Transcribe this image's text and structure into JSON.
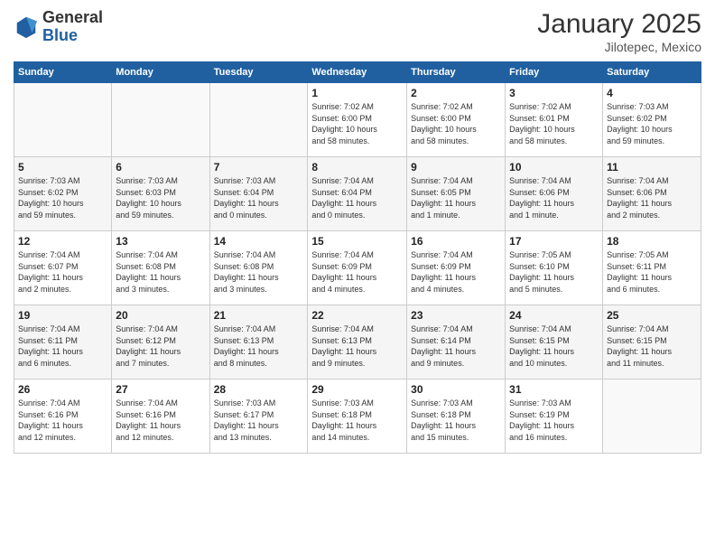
{
  "header": {
    "logo_general": "General",
    "logo_blue": "Blue",
    "month": "January 2025",
    "location": "Jilotepec, Mexico"
  },
  "weekdays": [
    "Sunday",
    "Monday",
    "Tuesday",
    "Wednesday",
    "Thursday",
    "Friday",
    "Saturday"
  ],
  "weeks": [
    [
      {
        "day": "",
        "info": ""
      },
      {
        "day": "",
        "info": ""
      },
      {
        "day": "",
        "info": ""
      },
      {
        "day": "1",
        "info": "Sunrise: 7:02 AM\nSunset: 6:00 PM\nDaylight: 10 hours\nand 58 minutes."
      },
      {
        "day": "2",
        "info": "Sunrise: 7:02 AM\nSunset: 6:00 PM\nDaylight: 10 hours\nand 58 minutes."
      },
      {
        "day": "3",
        "info": "Sunrise: 7:02 AM\nSunset: 6:01 PM\nDaylight: 10 hours\nand 58 minutes."
      },
      {
        "day": "4",
        "info": "Sunrise: 7:03 AM\nSunset: 6:02 PM\nDaylight: 10 hours\nand 59 minutes."
      }
    ],
    [
      {
        "day": "5",
        "info": "Sunrise: 7:03 AM\nSunset: 6:02 PM\nDaylight: 10 hours\nand 59 minutes."
      },
      {
        "day": "6",
        "info": "Sunrise: 7:03 AM\nSunset: 6:03 PM\nDaylight: 10 hours\nand 59 minutes."
      },
      {
        "day": "7",
        "info": "Sunrise: 7:03 AM\nSunset: 6:04 PM\nDaylight: 11 hours\nand 0 minutes."
      },
      {
        "day": "8",
        "info": "Sunrise: 7:04 AM\nSunset: 6:04 PM\nDaylight: 11 hours\nand 0 minutes."
      },
      {
        "day": "9",
        "info": "Sunrise: 7:04 AM\nSunset: 6:05 PM\nDaylight: 11 hours\nand 1 minute."
      },
      {
        "day": "10",
        "info": "Sunrise: 7:04 AM\nSunset: 6:06 PM\nDaylight: 11 hours\nand 1 minute."
      },
      {
        "day": "11",
        "info": "Sunrise: 7:04 AM\nSunset: 6:06 PM\nDaylight: 11 hours\nand 2 minutes."
      }
    ],
    [
      {
        "day": "12",
        "info": "Sunrise: 7:04 AM\nSunset: 6:07 PM\nDaylight: 11 hours\nand 2 minutes."
      },
      {
        "day": "13",
        "info": "Sunrise: 7:04 AM\nSunset: 6:08 PM\nDaylight: 11 hours\nand 3 minutes."
      },
      {
        "day": "14",
        "info": "Sunrise: 7:04 AM\nSunset: 6:08 PM\nDaylight: 11 hours\nand 3 minutes."
      },
      {
        "day": "15",
        "info": "Sunrise: 7:04 AM\nSunset: 6:09 PM\nDaylight: 11 hours\nand 4 minutes."
      },
      {
        "day": "16",
        "info": "Sunrise: 7:04 AM\nSunset: 6:09 PM\nDaylight: 11 hours\nand 4 minutes."
      },
      {
        "day": "17",
        "info": "Sunrise: 7:05 AM\nSunset: 6:10 PM\nDaylight: 11 hours\nand 5 minutes."
      },
      {
        "day": "18",
        "info": "Sunrise: 7:05 AM\nSunset: 6:11 PM\nDaylight: 11 hours\nand 6 minutes."
      }
    ],
    [
      {
        "day": "19",
        "info": "Sunrise: 7:04 AM\nSunset: 6:11 PM\nDaylight: 11 hours\nand 6 minutes."
      },
      {
        "day": "20",
        "info": "Sunrise: 7:04 AM\nSunset: 6:12 PM\nDaylight: 11 hours\nand 7 minutes."
      },
      {
        "day": "21",
        "info": "Sunrise: 7:04 AM\nSunset: 6:13 PM\nDaylight: 11 hours\nand 8 minutes."
      },
      {
        "day": "22",
        "info": "Sunrise: 7:04 AM\nSunset: 6:13 PM\nDaylight: 11 hours\nand 9 minutes."
      },
      {
        "day": "23",
        "info": "Sunrise: 7:04 AM\nSunset: 6:14 PM\nDaylight: 11 hours\nand 9 minutes."
      },
      {
        "day": "24",
        "info": "Sunrise: 7:04 AM\nSunset: 6:15 PM\nDaylight: 11 hours\nand 10 minutes."
      },
      {
        "day": "25",
        "info": "Sunrise: 7:04 AM\nSunset: 6:15 PM\nDaylight: 11 hours\nand 11 minutes."
      }
    ],
    [
      {
        "day": "26",
        "info": "Sunrise: 7:04 AM\nSunset: 6:16 PM\nDaylight: 11 hours\nand 12 minutes."
      },
      {
        "day": "27",
        "info": "Sunrise: 7:04 AM\nSunset: 6:16 PM\nDaylight: 11 hours\nand 12 minutes."
      },
      {
        "day": "28",
        "info": "Sunrise: 7:03 AM\nSunset: 6:17 PM\nDaylight: 11 hours\nand 13 minutes."
      },
      {
        "day": "29",
        "info": "Sunrise: 7:03 AM\nSunset: 6:18 PM\nDaylight: 11 hours\nand 14 minutes."
      },
      {
        "day": "30",
        "info": "Sunrise: 7:03 AM\nSunset: 6:18 PM\nDaylight: 11 hours\nand 15 minutes."
      },
      {
        "day": "31",
        "info": "Sunrise: 7:03 AM\nSunset: 6:19 PM\nDaylight: 11 hours\nand 16 minutes."
      },
      {
        "day": "",
        "info": ""
      }
    ]
  ]
}
